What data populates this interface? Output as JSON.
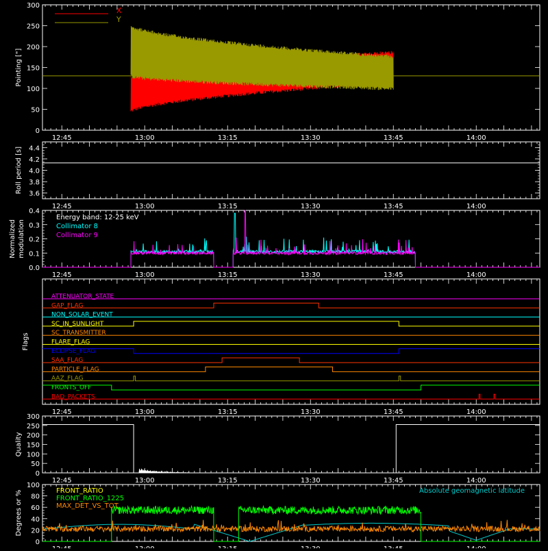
{
  "chart_data": [
    {
      "type": "line",
      "ylabel": "Pointing [\"]",
      "ylim": [
        0,
        300
      ],
      "yticks": [
        "0",
        "50",
        "100",
        "150",
        "200",
        "250",
        "300"
      ],
      "xticks": [
        "12:45",
        "13:00",
        "13:15",
        "13:30",
        "13:45",
        "14:00"
      ],
      "xrange_min": [
        -3.5,
        86.5
      ],
      "series": [
        {
          "name": "X",
          "color": "#ff0000",
          "t_start": 12.5,
          "t_end": 60,
          "start_min": 40,
          "start_max": 130,
          "end_min": 110,
          "end_max": 190
        },
        {
          "name": "Y",
          "color": "#999900",
          "t_start": 12.5,
          "t_end": 60,
          "start_min": 125,
          "start_max": 255,
          "end_min": 95,
          "end_max": 180
        }
      ],
      "reference_line": 130
    },
    {
      "type": "line",
      "ylabel": "Roll period [s]",
      "ylim": [
        3.5,
        4.5
      ],
      "yticks": [
        "3.6",
        "3.8",
        "4.0",
        "4.2",
        "4.4"
      ],
      "xticks": [
        "12:45",
        "13:00",
        "13:15",
        "13:30",
        "13:45",
        "14:00"
      ],
      "value": 4.13
    },
    {
      "type": "line",
      "ylabel": "Normalized modulation",
      "ylim": [
        0,
        0.4
      ],
      "yticks": [
        "0.0",
        "0.1",
        "0.2",
        "0.3",
        "0.4"
      ],
      "xticks": [
        "12:45",
        "13:00",
        "13:15",
        "13:30",
        "13:45",
        "14:00"
      ],
      "legend": [
        "Energy band: 12-25 keV",
        "Collimator 8",
        "Collimator 9"
      ],
      "series": [
        {
          "name": "Collimator 8",
          "color": "#00ffff",
          "segments": [
            [
              12.5,
              27.5
            ],
            [
              31,
              64
            ]
          ],
          "base": 0.1
        },
        {
          "name": "Collimator 9",
          "color": "#ff00ff",
          "segments": [
            [
              12.5,
              27.5
            ],
            [
              31,
              64
            ]
          ],
          "base": 0.09
        }
      ]
    },
    {
      "type": "line",
      "ylabel": "Flags",
      "xticks": [
        "12:45",
        "13:00",
        "13:15",
        "13:30",
        "13:45",
        "14:00"
      ],
      "flags": [
        {
          "name": "ATTENUATOR_STATE",
          "color": "#ff00ff",
          "steps": [
            [
              -3.5,
              0
            ]
          ]
        },
        {
          "name": "GAP_FLAG",
          "color": "#ff3300",
          "steps": [
            [
              -3.5,
              0
            ],
            [
              27.5,
              1
            ],
            [
              46.5,
              0
            ]
          ]
        },
        {
          "name": "NON_SOLAR_EVENT",
          "color": "#00ffff",
          "steps": [
            [
              -3.5,
              0
            ]
          ]
        },
        {
          "name": "SC_IN_SUNLIGHT",
          "color": "#ffff00",
          "steps": [
            [
              -3.5,
              0
            ],
            [
              13,
              1
            ],
            [
              61,
              0
            ]
          ]
        },
        {
          "name": "SC_TRANSMITTER",
          "color": "#ff8800",
          "steps": [
            [
              -3.5,
              0
            ]
          ]
        },
        {
          "name": "FLARE_FLAG",
          "color": "#ffff00",
          "steps": [
            [
              -3.5,
              0
            ]
          ]
        },
        {
          "name": "ECLIPSE_FLAG",
          "color": "#0000ff",
          "steps": [
            [
              -3.5,
              1
            ],
            [
              13,
              0
            ],
            [
              61,
              1
            ]
          ]
        },
        {
          "name": "SAA_FLAG",
          "color": "#ff3300",
          "steps": [
            [
              -3.5,
              0
            ],
            [
              29,
              1
            ],
            [
              43,
              0
            ]
          ]
        },
        {
          "name": "PARTICLE_FLAG",
          "color": "#ff8800",
          "steps": [
            [
              -3.5,
              0
            ],
            [
              26,
              1
            ],
            [
              49,
              0
            ]
          ]
        },
        {
          "name": "AAZ_FLAG",
          "color": "#999900",
          "steps": [
            [
              -3.5,
              0
            ],
            [
              13,
              1
            ],
            [
              13.3,
              0
            ],
            [
              61,
              1
            ],
            [
              61.3,
              0
            ]
          ]
        },
        {
          "name": "FRONTS_OFF",
          "color": "#00ff00",
          "steps": [
            [
              -3.5,
              1
            ],
            [
              9,
              0
            ],
            [
              65,
              1
            ]
          ]
        },
        {
          "name": "BAD_PACKETS",
          "color": "#ff0000",
          "steps": [
            [
              -3.5,
              0
            ],
            [
              75.5,
              1
            ],
            [
              75.7,
              0
            ],
            [
              78.2,
              1
            ],
            [
              78.4,
              0
            ]
          ]
        }
      ]
    },
    {
      "type": "line",
      "ylabel": "Quality",
      "ylim": [
        0,
        300
      ],
      "yticks": [
        "0",
        "50",
        "100",
        "150",
        "200",
        "250",
        "300"
      ],
      "xticks": [
        "12:45",
        "13:00",
        "13:15",
        "13:30",
        "13:45",
        "14:00"
      ],
      "steps": [
        [
          -3.5,
          255
        ],
        [
          13,
          0
        ],
        [
          60.5,
          255
        ],
        [
          86.5,
          255
        ]
      ]
    },
    {
      "type": "line",
      "ylabel": "Degrees or %",
      "ylim": [
        0,
        100
      ],
      "yticks": [
        "0",
        "20",
        "40",
        "60",
        "80",
        "100"
      ],
      "xticks": [
        "12:45",
        "13:00",
        "13:15",
        "13:30",
        "13:45",
        "14:00"
      ],
      "annotation": "Absolute geomagnetic latitude",
      "series": [
        {
          "name": "FRONT_RATIO",
          "color": "#ffff00"
        },
        {
          "name": "FRONT_RATIO_1225",
          "color": "#00ff00",
          "segments": [
            [
              9,
              27.5
            ],
            [
              32,
              65
            ]
          ],
          "level": 55
        },
        {
          "name": "MAX_DET_VS_TOT",
          "color": "#ff8800",
          "level": 22
        },
        {
          "name": "Absolute geomagnetic latitude",
          "color": "#00cccc"
        }
      ]
    }
  ]
}
